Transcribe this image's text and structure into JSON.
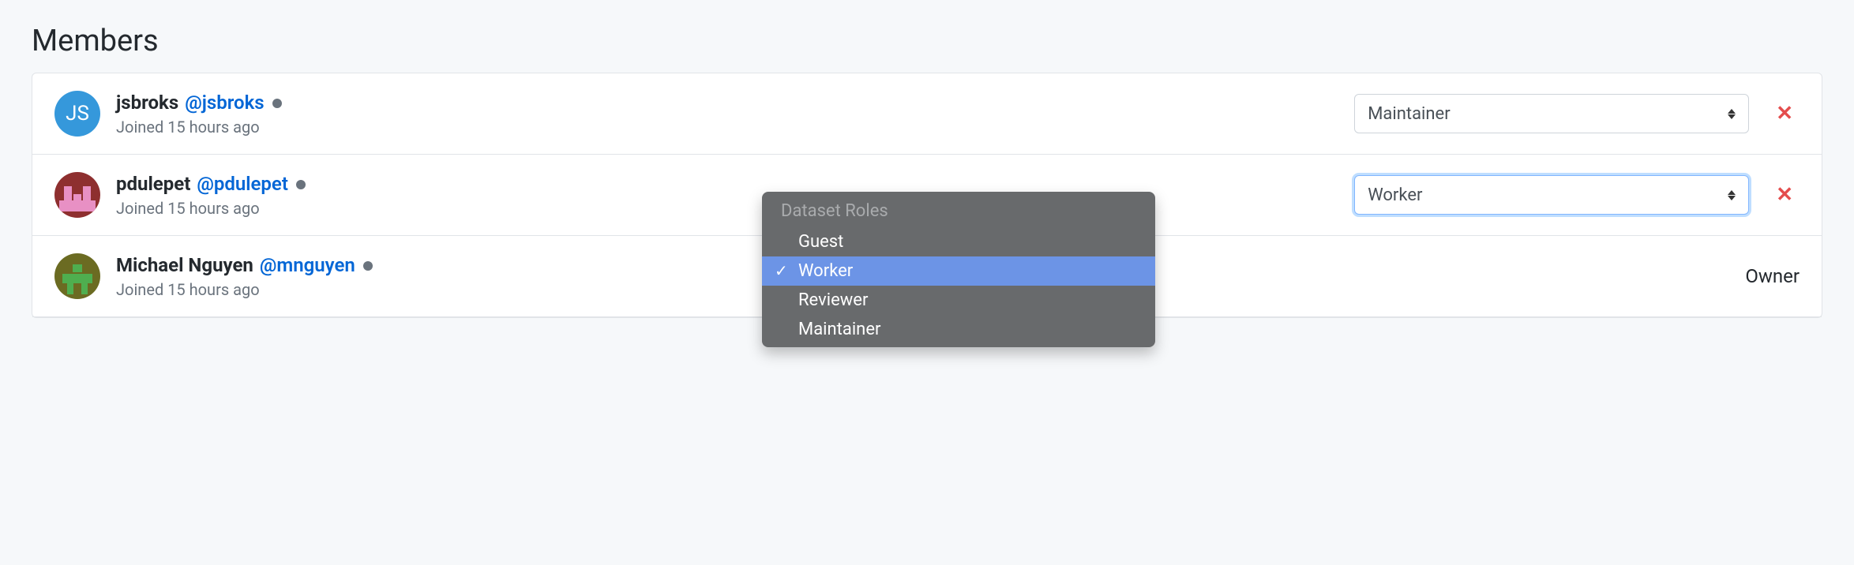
{
  "page_title": "Members",
  "dropdown": {
    "header": "Dataset Roles",
    "options": [
      "Guest",
      "Worker",
      "Reviewer",
      "Maintainer"
    ],
    "selected_index": 1
  },
  "members": [
    {
      "avatar_type": "initials",
      "initials": "JS",
      "avatar_bg": "#3598db",
      "name": "jsbroks",
      "handle": "@jsbroks",
      "joined": "Joined 15 hours ago",
      "role": "Maintainer",
      "removable": true
    },
    {
      "avatar_type": "identicon1",
      "name": "pdulepet",
      "handle": "@pdulepet",
      "joined": "Joined 15 hours ago",
      "role": "Worker",
      "removable": true,
      "select_focused": true
    },
    {
      "avatar_type": "identicon2",
      "name": "Michael Nguyen",
      "handle": "@mnguyen",
      "joined": "Joined 15 hours ago",
      "owner_label": "Owner",
      "removable": false
    }
  ]
}
